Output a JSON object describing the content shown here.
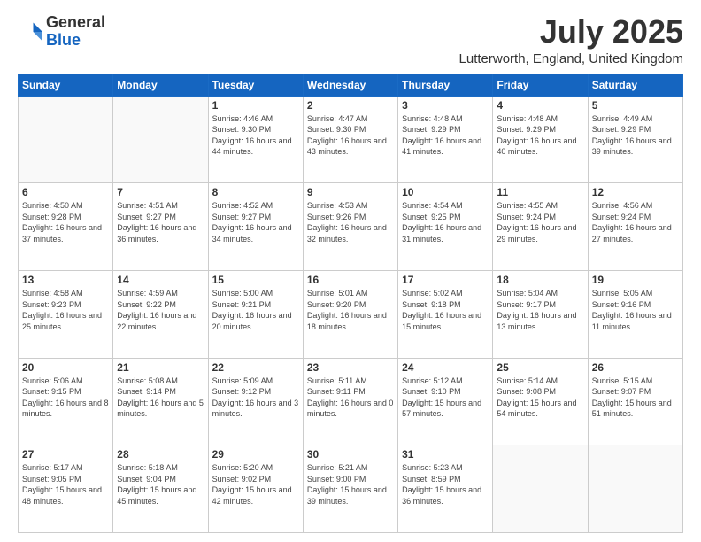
{
  "header": {
    "logo_general": "General",
    "logo_blue": "Blue",
    "month_title": "July 2025",
    "location": "Lutterworth, England, United Kingdom"
  },
  "days_of_week": [
    "Sunday",
    "Monday",
    "Tuesday",
    "Wednesday",
    "Thursday",
    "Friday",
    "Saturday"
  ],
  "weeks": [
    [
      {
        "day": "",
        "info": ""
      },
      {
        "day": "",
        "info": ""
      },
      {
        "day": "1",
        "info": "Sunrise: 4:46 AM\nSunset: 9:30 PM\nDaylight: 16 hours\nand 44 minutes."
      },
      {
        "day": "2",
        "info": "Sunrise: 4:47 AM\nSunset: 9:30 PM\nDaylight: 16 hours\nand 43 minutes."
      },
      {
        "day": "3",
        "info": "Sunrise: 4:48 AM\nSunset: 9:29 PM\nDaylight: 16 hours\nand 41 minutes."
      },
      {
        "day": "4",
        "info": "Sunrise: 4:48 AM\nSunset: 9:29 PM\nDaylight: 16 hours\nand 40 minutes."
      },
      {
        "day": "5",
        "info": "Sunrise: 4:49 AM\nSunset: 9:29 PM\nDaylight: 16 hours\nand 39 minutes."
      }
    ],
    [
      {
        "day": "6",
        "info": "Sunrise: 4:50 AM\nSunset: 9:28 PM\nDaylight: 16 hours\nand 37 minutes."
      },
      {
        "day": "7",
        "info": "Sunrise: 4:51 AM\nSunset: 9:27 PM\nDaylight: 16 hours\nand 36 minutes."
      },
      {
        "day": "8",
        "info": "Sunrise: 4:52 AM\nSunset: 9:27 PM\nDaylight: 16 hours\nand 34 minutes."
      },
      {
        "day": "9",
        "info": "Sunrise: 4:53 AM\nSunset: 9:26 PM\nDaylight: 16 hours\nand 32 minutes."
      },
      {
        "day": "10",
        "info": "Sunrise: 4:54 AM\nSunset: 9:25 PM\nDaylight: 16 hours\nand 31 minutes."
      },
      {
        "day": "11",
        "info": "Sunrise: 4:55 AM\nSunset: 9:24 PM\nDaylight: 16 hours\nand 29 minutes."
      },
      {
        "day": "12",
        "info": "Sunrise: 4:56 AM\nSunset: 9:24 PM\nDaylight: 16 hours\nand 27 minutes."
      }
    ],
    [
      {
        "day": "13",
        "info": "Sunrise: 4:58 AM\nSunset: 9:23 PM\nDaylight: 16 hours\nand 25 minutes."
      },
      {
        "day": "14",
        "info": "Sunrise: 4:59 AM\nSunset: 9:22 PM\nDaylight: 16 hours\nand 22 minutes."
      },
      {
        "day": "15",
        "info": "Sunrise: 5:00 AM\nSunset: 9:21 PM\nDaylight: 16 hours\nand 20 minutes."
      },
      {
        "day": "16",
        "info": "Sunrise: 5:01 AM\nSunset: 9:20 PM\nDaylight: 16 hours\nand 18 minutes."
      },
      {
        "day": "17",
        "info": "Sunrise: 5:02 AM\nSunset: 9:18 PM\nDaylight: 16 hours\nand 15 minutes."
      },
      {
        "day": "18",
        "info": "Sunrise: 5:04 AM\nSunset: 9:17 PM\nDaylight: 16 hours\nand 13 minutes."
      },
      {
        "day": "19",
        "info": "Sunrise: 5:05 AM\nSunset: 9:16 PM\nDaylight: 16 hours\nand 11 minutes."
      }
    ],
    [
      {
        "day": "20",
        "info": "Sunrise: 5:06 AM\nSunset: 9:15 PM\nDaylight: 16 hours\nand 8 minutes."
      },
      {
        "day": "21",
        "info": "Sunrise: 5:08 AM\nSunset: 9:14 PM\nDaylight: 16 hours\nand 5 minutes."
      },
      {
        "day": "22",
        "info": "Sunrise: 5:09 AM\nSunset: 9:12 PM\nDaylight: 16 hours\nand 3 minutes."
      },
      {
        "day": "23",
        "info": "Sunrise: 5:11 AM\nSunset: 9:11 PM\nDaylight: 16 hours\nand 0 minutes."
      },
      {
        "day": "24",
        "info": "Sunrise: 5:12 AM\nSunset: 9:10 PM\nDaylight: 15 hours\nand 57 minutes."
      },
      {
        "day": "25",
        "info": "Sunrise: 5:14 AM\nSunset: 9:08 PM\nDaylight: 15 hours\nand 54 minutes."
      },
      {
        "day": "26",
        "info": "Sunrise: 5:15 AM\nSunset: 9:07 PM\nDaylight: 15 hours\nand 51 minutes."
      }
    ],
    [
      {
        "day": "27",
        "info": "Sunrise: 5:17 AM\nSunset: 9:05 PM\nDaylight: 15 hours\nand 48 minutes."
      },
      {
        "day": "28",
        "info": "Sunrise: 5:18 AM\nSunset: 9:04 PM\nDaylight: 15 hours\nand 45 minutes."
      },
      {
        "day": "29",
        "info": "Sunrise: 5:20 AM\nSunset: 9:02 PM\nDaylight: 15 hours\nand 42 minutes."
      },
      {
        "day": "30",
        "info": "Sunrise: 5:21 AM\nSunset: 9:00 PM\nDaylight: 15 hours\nand 39 minutes."
      },
      {
        "day": "31",
        "info": "Sunrise: 5:23 AM\nSunset: 8:59 PM\nDaylight: 15 hours\nand 36 minutes."
      },
      {
        "day": "",
        "info": ""
      },
      {
        "day": "",
        "info": ""
      }
    ]
  ]
}
